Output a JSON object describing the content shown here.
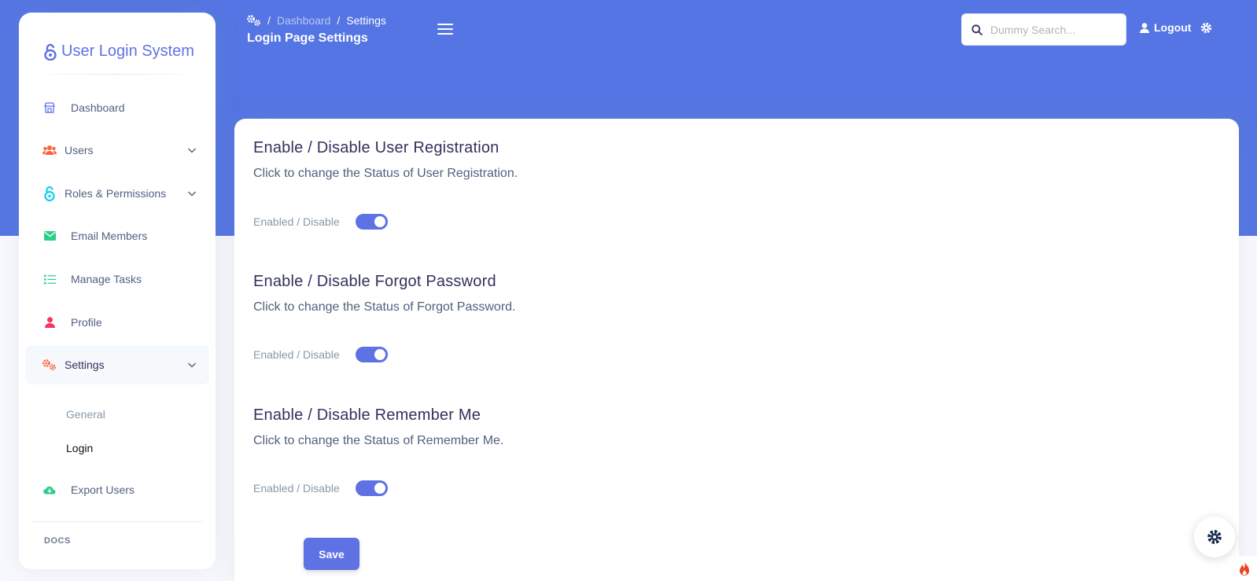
{
  "brand": {
    "name": "User Login System"
  },
  "sidebar": {
    "items": [
      {
        "label": "Dashboard"
      },
      {
        "label": "Users"
      },
      {
        "label": "Roles & Permissions"
      },
      {
        "label": "Email Members"
      },
      {
        "label": "Manage Tasks"
      },
      {
        "label": "Profile"
      },
      {
        "label": "Settings"
      },
      {
        "label": "Export Users"
      }
    ],
    "settings_sub": [
      {
        "label": "General"
      },
      {
        "label": "Login"
      }
    ],
    "docs_label": "DOCS"
  },
  "header": {
    "breadcrumb": {
      "dashboard": "Dashboard",
      "current": "Settings",
      "sep": "/"
    },
    "title": "Login Page Settings",
    "search_placeholder": "Dummy Search...",
    "logout": "Logout"
  },
  "sections": [
    {
      "title": "Enable / Disable User Registration",
      "desc": "Click to change the Status of User Registration.",
      "toggle_label": "Enabled / Disable",
      "enabled": true
    },
    {
      "title": "Enable / Disable Forgot Password",
      "desc": "Click to change the Status of Forgot Password.",
      "toggle_label": "Enabled / Disable",
      "enabled": true
    },
    {
      "title": "Enable / Disable Remember Me",
      "desc": "Click to change the Status of Remember Me.",
      "toggle_label": "Enabled / Disable",
      "enabled": true
    }
  ],
  "save_label": "Save",
  "colors": {
    "primary": "#5e72e4",
    "header_bg": "#5475e3",
    "users_icon": "#fb6340",
    "roles_icon": "#11cdef",
    "email_icon": "#2dce89",
    "tasks_icon": "#2dce89",
    "profile_icon": "#f5365c",
    "settings_icon": "#fb6340",
    "export_icon": "#2dce89"
  },
  "icons": [
    "lock-icon",
    "shop-icon",
    "users-icon",
    "unlock-icon",
    "envelope-icon",
    "list-icon",
    "user-icon",
    "gears-icon",
    "cloud-download-icon",
    "search-icon",
    "gear-icon",
    "flame-icon",
    "chevron-down-icon",
    "hamburger-icon"
  ]
}
